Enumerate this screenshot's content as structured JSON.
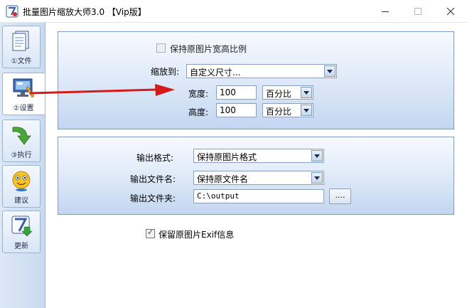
{
  "window": {
    "title": "批量图片缩放大师3.0 【Vip版】"
  },
  "sidebar": {
    "items": [
      {
        "label": "①文件",
        "icon": "document-icon"
      },
      {
        "label": "②设置",
        "icon": "settings-monitor-icon"
      },
      {
        "label": "③执行",
        "icon": "green-arrow-icon"
      },
      {
        "label": "建议",
        "icon": "smiley-icon"
      },
      {
        "label": "更新",
        "icon": "update-logo-icon"
      }
    ]
  },
  "settings": {
    "keep_ratio_label": "保持原图片宽高比例",
    "keep_ratio_checked": false,
    "scale_to_label": "缩放到:",
    "scale_to_value": "自定义尺寸...",
    "width_label": "宽度:",
    "width_value": "100",
    "width_unit": "百分比",
    "height_label": "高度:",
    "height_value": "100",
    "height_unit": "百分比"
  },
  "output": {
    "format_label": "输出格式:",
    "format_value": "保持原图片格式",
    "filename_label": "输出文件名:",
    "filename_value": "保持原文件名",
    "folder_label": "输出文件夹:",
    "folder_value": "C:\\output",
    "browse_label": "....",
    "keep_exif_label": "保留原图片Exif信息",
    "keep_exif_checked": true
  },
  "colors": {
    "panel_border": "#7f9dc7",
    "panel_gradient_bottom": "#c3d6f0",
    "annotation_arrow": "#d61a1a"
  }
}
